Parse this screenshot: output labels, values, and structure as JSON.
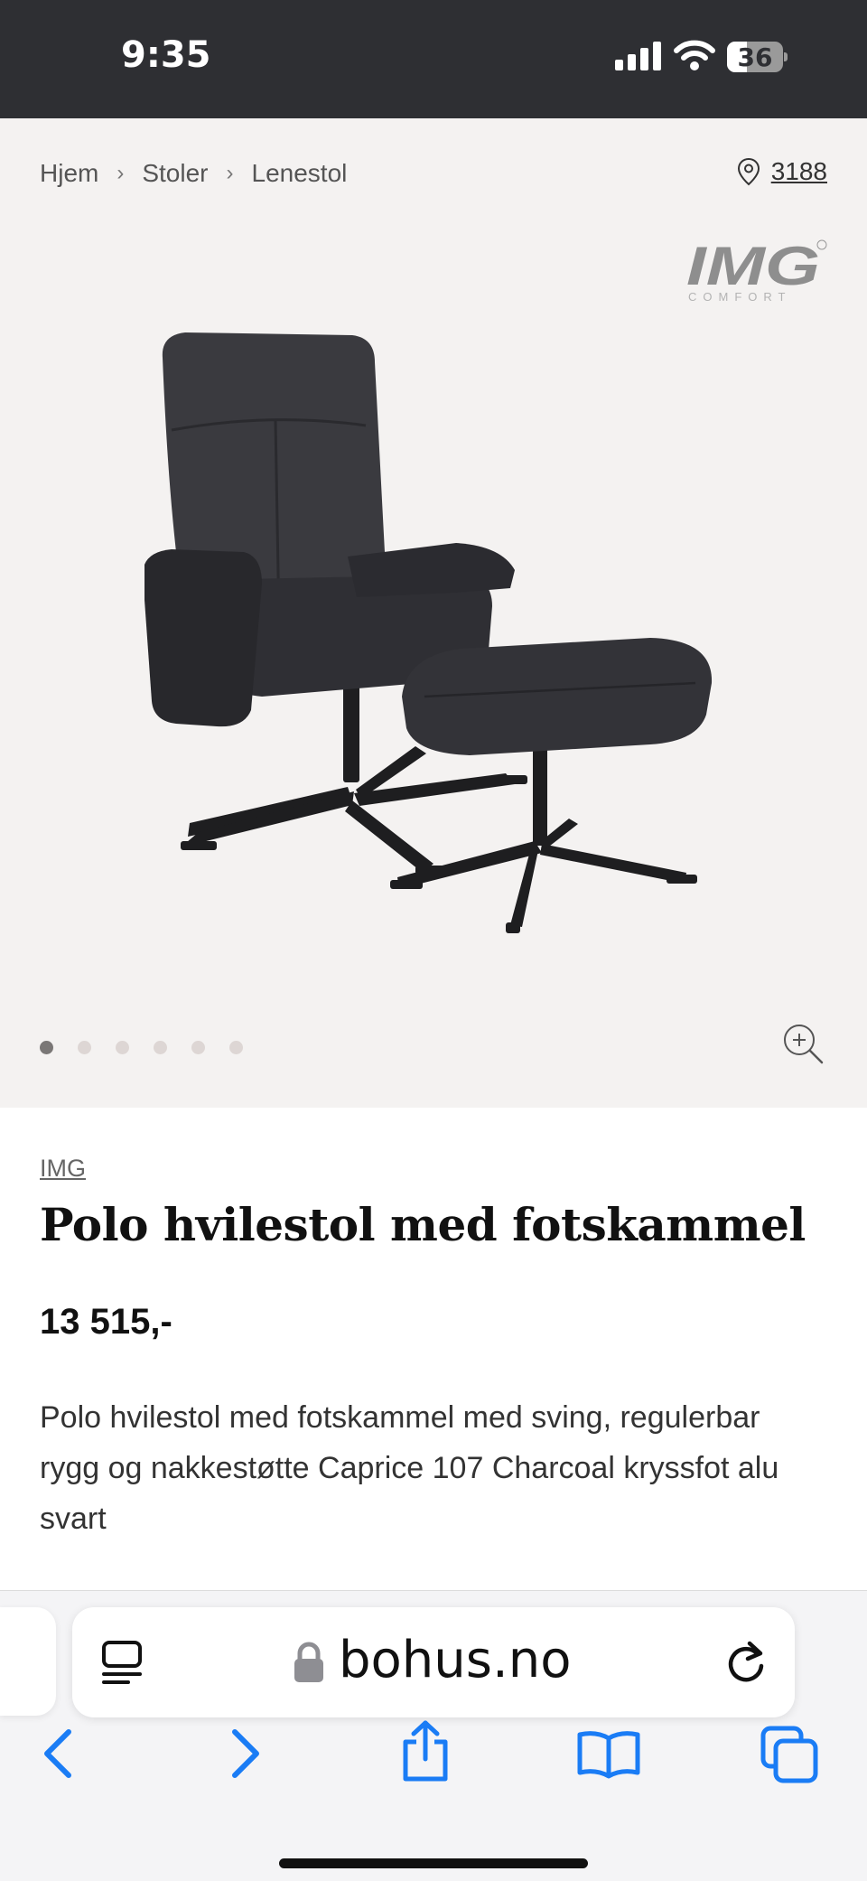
{
  "status_bar": {
    "time": "9:35",
    "battery": "36",
    "battery_level": 0.36
  },
  "breadcrumb": [
    "Hjem",
    "Stoler",
    "Lenestol"
  ],
  "location": {
    "icon": "map-pin-icon",
    "text": "3188"
  },
  "brand_logo": {
    "text": "IMG",
    "sub": "COMFORT"
  },
  "gallery": {
    "count": 6,
    "active_index": 0,
    "zoom_icon": "zoom-in-icon"
  },
  "product": {
    "brand": "IMG",
    "title": "Polo hvilestol med fotskammel",
    "price": "13 515,-",
    "description": "Polo hvilestol med fotskammel med sving, regulerbar rygg og nakkestøtte Caprice 107 Charcoal kryssfot alu svart"
  },
  "browser": {
    "url": "bohus.no",
    "toolbar_icons": [
      "back-icon",
      "forward-icon",
      "share-icon",
      "bookmarks-icon",
      "tabs-icon"
    ]
  },
  "colors": {
    "accent": "#1a7cf5",
    "status_bar": "#2e2f33",
    "hero_bg": "#f4f2f1"
  }
}
